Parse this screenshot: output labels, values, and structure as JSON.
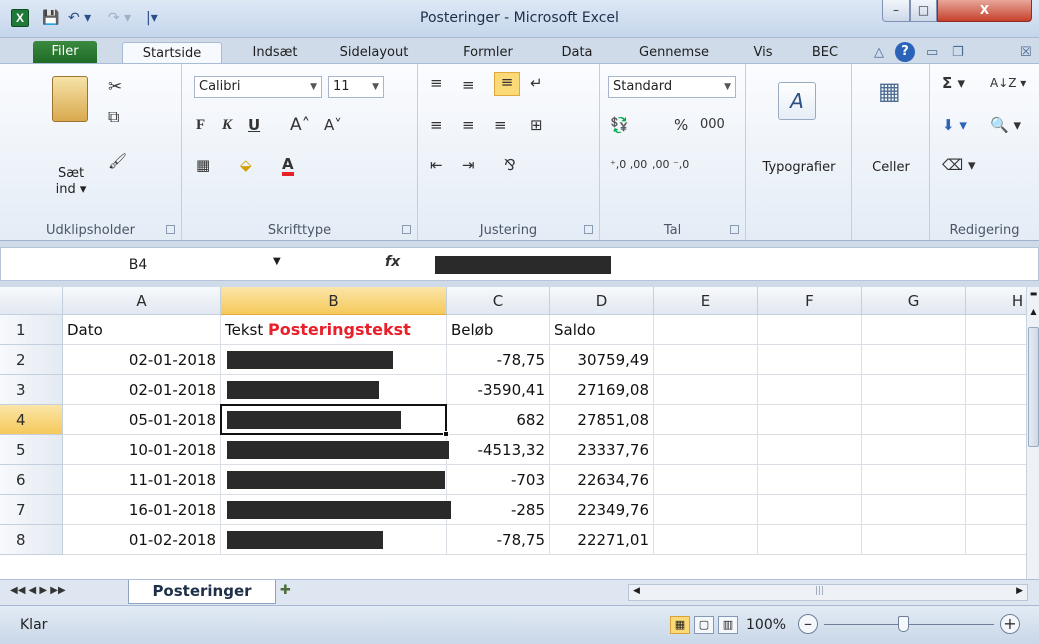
{
  "window": {
    "title": "Posteringer - Microsoft Excel",
    "app_icon": "X",
    "min_glyph": "–",
    "max_glyph": "□",
    "close_glyph": "X"
  },
  "qat": {
    "save": "💾",
    "undo": "↶ ▾",
    "redo": "↷ ▾",
    "customize": "|▾"
  },
  "tabs": [
    "Filer",
    "Startside",
    "Indsæt",
    "Sidelayout",
    "Formler",
    "Data",
    "Gennemse",
    "Vis",
    "BEC"
  ],
  "ribbon_tools": {
    "minimize": "△",
    "help": "?",
    "restore_min": "▭",
    "restore": "❐",
    "close": "☒"
  },
  "ribbon": {
    "clipboard": {
      "label": "Udklipsholder",
      "paste": "Sæt ind ▾",
      "cut_icon": "✂",
      "copy_icon": "⧉",
      "painter_icon": "🖌"
    },
    "font": {
      "label": "Skrifttype",
      "name": "Calibri",
      "size": "11",
      "bold": "F",
      "italic": "K",
      "underline": "U",
      "grow": "A˄",
      "shrink": "A˅",
      "borders": "▦",
      "fill": "⬙",
      "fontcolor": "A"
    },
    "alignment": {
      "label": "Justering",
      "icons": [
        "≡",
        "≡",
        "≡",
        "↵",
        "≡",
        "≡",
        "≡",
        "⊞",
        "⇤",
        "⇥",
        "⅋"
      ]
    },
    "number": {
      "label": "Tal",
      "format": "Standard",
      "currency": "💱",
      "percent": "%",
      "thousands": "000",
      "inc_dec": "⁺,0 ,00",
      "dec_dec": ",00 ⁻,0"
    },
    "styles": {
      "label": "Typografier",
      "icon": "A"
    },
    "cells": {
      "label": "Celler",
      "icon": "▦"
    },
    "editing": {
      "label": "Redigering",
      "sum": "Σ ▾",
      "sort": "A↓Z ▾",
      "fill": "⬇ ▾",
      "find": "🔍 ▾",
      "clear": "⌫ ▾"
    }
  },
  "formula_bar": {
    "name_box": "B4",
    "fx": "fx"
  },
  "columns": [
    "A",
    "B",
    "C",
    "D",
    "E",
    "F",
    "G",
    "H"
  ],
  "header_row": {
    "a": "Dato",
    "b_prefix": "Tekst",
    "b_highlight": "Posteringstekst",
    "c": "Beløb",
    "d": "Saldo"
  },
  "rows": [
    {
      "num": "2",
      "date": "02-01-2018",
      "amount": "-78,75",
      "balance": "30759,49"
    },
    {
      "num": "3",
      "date": "02-01-2018",
      "amount": "-3590,41",
      "balance": "27169,08"
    },
    {
      "num": "4",
      "date": "05-01-2018",
      "amount": "682",
      "balance": "27851,08"
    },
    {
      "num": "5",
      "date": "10-01-2018",
      "amount": "-4513,32",
      "balance": "23337,76"
    },
    {
      "num": "6",
      "date": "11-01-2018",
      "amount": "-703",
      "balance": "22634,76"
    },
    {
      "num": "7",
      "date": "16-01-2018",
      "amount": "-285",
      "balance": "22349,76"
    },
    {
      "num": "8",
      "date": "01-02-2018",
      "amount": "-78,75",
      "balance": "22271,01"
    }
  ],
  "sheet_tabs": {
    "active": "Posteringer",
    "nav": "◀◀ ◀ ▶ ▶▶"
  },
  "status": {
    "text": "Klar",
    "zoom": "100%",
    "zoom_level_percent": 100
  },
  "colors": {
    "accent": "#e8202a",
    "file_tab": "#2a7a30",
    "selection": "#f5c95a"
  }
}
